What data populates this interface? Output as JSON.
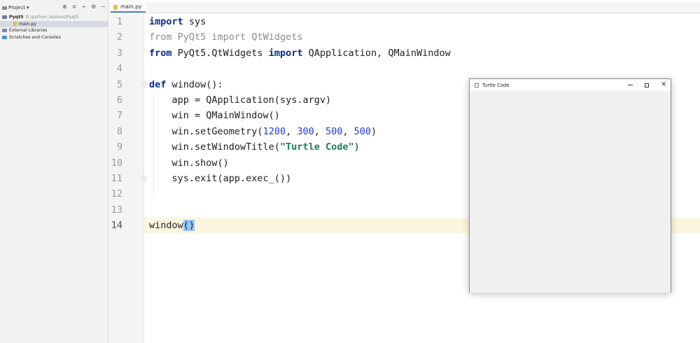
{
  "sidebar": {
    "header_label": "Project",
    "header_caret": "▾",
    "tools": [
      "⊕",
      "≑",
      "÷",
      "⚙",
      "−"
    ],
    "items": [
      {
        "label": "Pyqt5",
        "path": "D:\\python_lessons\\Pyqt5",
        "icon": "folder-icon"
      },
      {
        "label": "main.py",
        "path": "",
        "icon": "python-file-icon"
      },
      {
        "label": "External Libraries",
        "path": "",
        "icon": "library-icon"
      },
      {
        "label": "Scratches and Consoles",
        "path": "",
        "icon": "scratch-icon"
      }
    ]
  },
  "tabbar": {
    "active_tab": "main.py"
  },
  "editor": {
    "line_numbers": [
      "1",
      "2",
      "3",
      "4",
      "5",
      "6",
      "7",
      "8",
      "9",
      "10",
      "11",
      "12",
      "13",
      "14"
    ],
    "current_line": "14",
    "lines": {
      "l1": {
        "kw": "import",
        "rest": " sys"
      },
      "l2": {
        "kw": "from",
        "mod": " PyQt5 ",
        "kw2": "import",
        "rest": " QtWidgets"
      },
      "l3": {
        "kw": "from",
        "mod": " PyQt5.QtWidgets ",
        "kw2": "import",
        "rest": " QApplication, QMainWindow"
      },
      "l5": {
        "kw": "def",
        "rest": " window():"
      },
      "l6": {
        "text": "    app = QApplication(sys.argv)"
      },
      "l7": {
        "text": "    win = QMainWindow()"
      },
      "l8": {
        "pre": "    win.setGeometry(",
        "n1": "1200",
        "c1": ", ",
        "n2": "300",
        "c2": ", ",
        "n3": "500",
        "c3": ", ",
        "n4": "500",
        "post": ")"
      },
      "l9": {
        "pre": "    win.setWindowTitle(",
        "str": "\"Turtle Code\"",
        "post": ")"
      },
      "l10": {
        "text": "    win.show()"
      },
      "l11": {
        "text": "    sys.exit(app.exec_())"
      },
      "l14": {
        "pre": "window",
        "paren": "()"
      }
    }
  },
  "qt_window": {
    "title": "Turtle Code",
    "minimize": "—",
    "maximize": "☐",
    "close": "✕"
  },
  "colors": {
    "keyword": "#0d2b8c",
    "number": "#1b3cc6",
    "string": "#1e7d55",
    "current_line": "#fcf6e1",
    "paren_highlight": "#93c3f5"
  }
}
